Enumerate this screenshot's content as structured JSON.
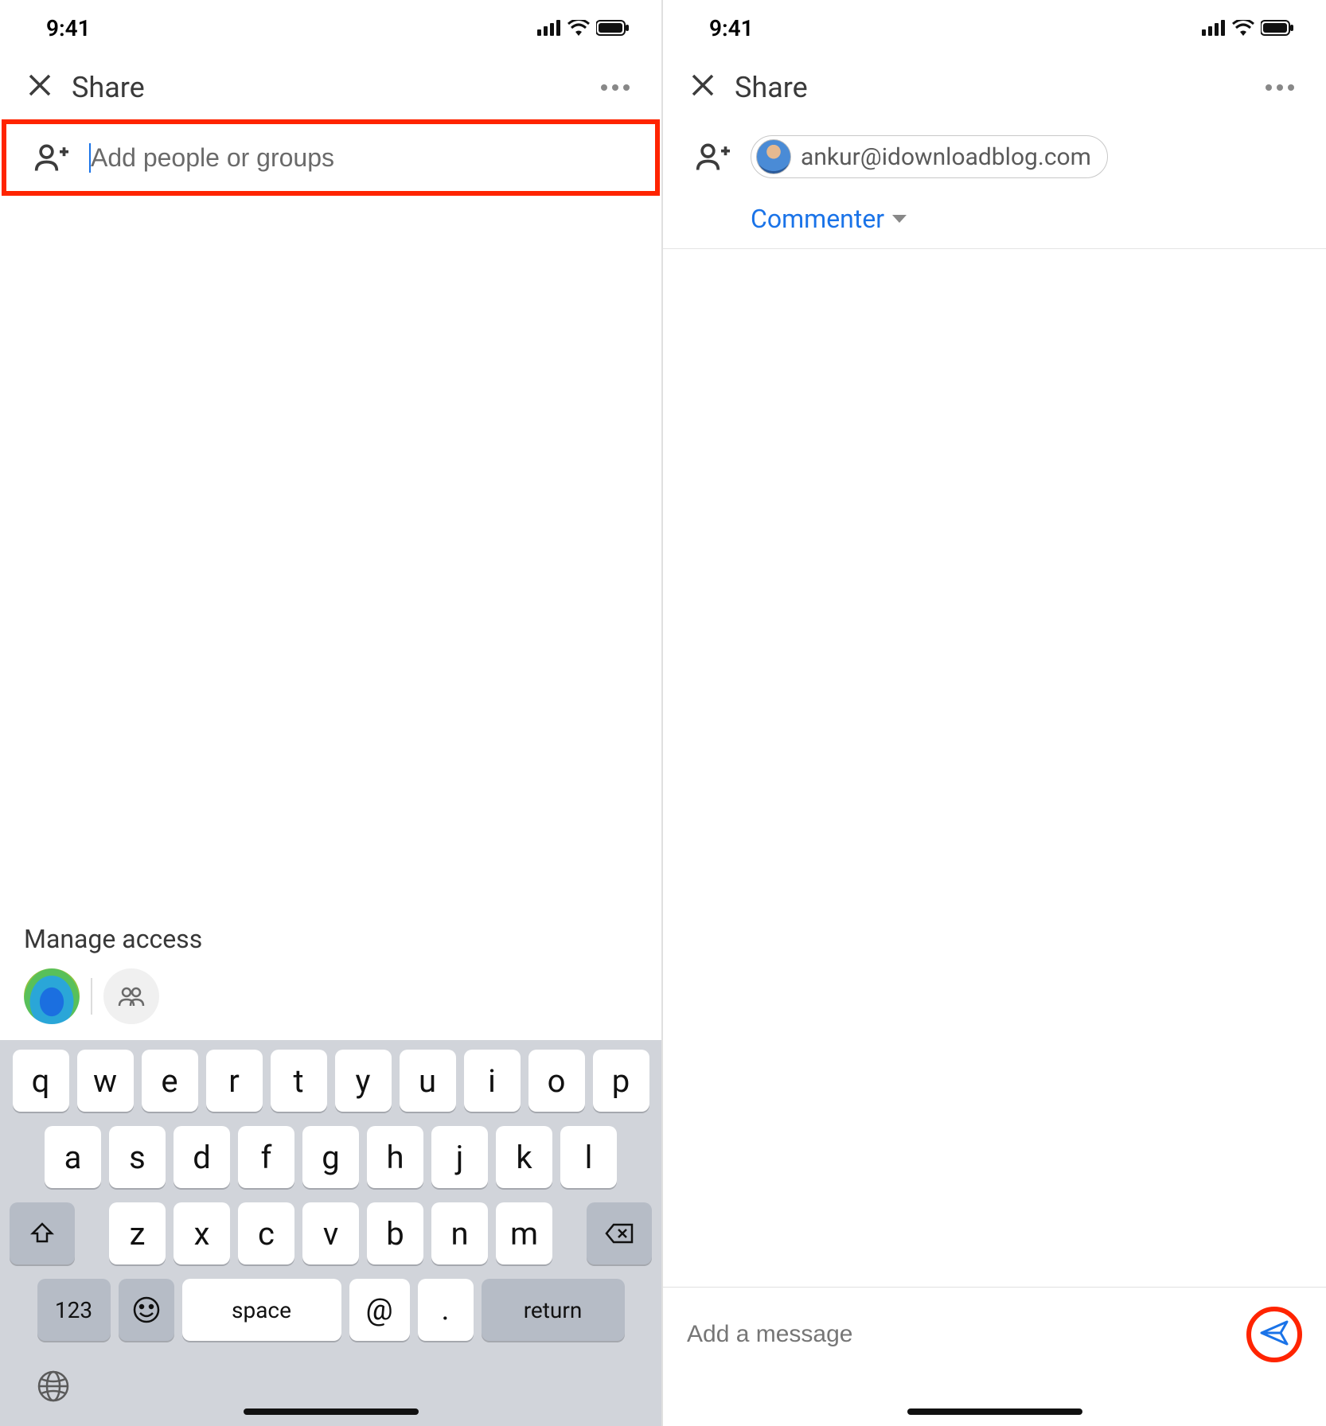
{
  "status": {
    "time": "9:41"
  },
  "header": {
    "title": "Share"
  },
  "left": {
    "add_placeholder": "Add people or groups",
    "manage_label": "Manage access"
  },
  "right": {
    "chip_email": "ankur@idownloadblog.com",
    "role_label": "Commenter",
    "compose_placeholder": "Add a message"
  },
  "keyboard": {
    "row1": [
      "q",
      "w",
      "e",
      "r",
      "t",
      "y",
      "u",
      "i",
      "o",
      "p"
    ],
    "row2": [
      "a",
      "s",
      "d",
      "f",
      "g",
      "h",
      "j",
      "k",
      "l"
    ],
    "row3": [
      "z",
      "x",
      "c",
      "v",
      "b",
      "n",
      "m"
    ],
    "k123": "123",
    "space": "space",
    "at": "@",
    "dot": ".",
    "ret": "return"
  }
}
